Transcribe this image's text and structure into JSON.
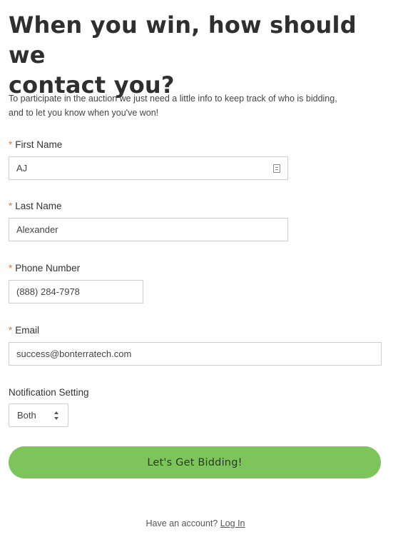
{
  "header": {
    "title_line1": "When you win, how should we",
    "title_line2": "contact you?"
  },
  "intro": {
    "line1": "To participate in the auction we just need a little info to keep track of who is bidding,",
    "line2": "and to let you know when you've won!"
  },
  "form": {
    "required_marker": "*",
    "first_name": {
      "label": "First Name",
      "value": "AJ",
      "icon": "autofill-contact-icon"
    },
    "last_name": {
      "label": "Last Name",
      "value": "Alexander"
    },
    "phone": {
      "label": "Phone Number",
      "value": "(888) 284-7978"
    },
    "email": {
      "label": "Email",
      "value": "success@bonterratech.com"
    },
    "notification": {
      "label": "Notification Setting",
      "selected": "Both"
    },
    "submit_label": "Let's Get Bidding!"
  },
  "footer": {
    "prompt": "Have an account?",
    "login_link": "Log In"
  },
  "colors": {
    "accent_green": "#7dc55a",
    "required_orange": "#e07a3a"
  }
}
